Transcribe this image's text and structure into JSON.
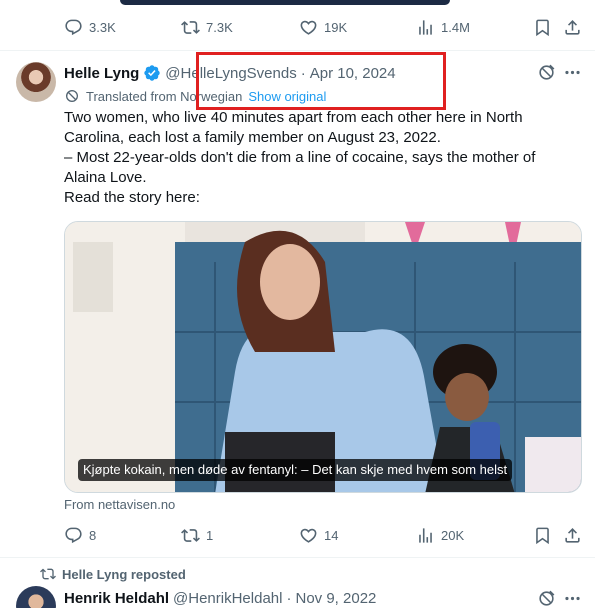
{
  "top_actions": {
    "replies": "3.3K",
    "reposts": "7.3K",
    "likes": "19K",
    "views": "1.4M"
  },
  "tweet": {
    "author_name": "Helle Lyng",
    "handle": "@HelleLyngSvends",
    "date": "Apr 10, 2024",
    "translated_label": "Translated from Norwegian",
    "show_original": "Show original",
    "text_lines": [
      "Two women, who live 40 minutes apart from each other here in North Carolina, each lost a family member on August 23, 2022.",
      "– Most 22-year-olds don't die from a line of cocaine, says the mother of Alaina Love.",
      "Read the story here:"
    ],
    "media_caption": "Kjøpte kokain, men døde av fentanyl: – Det kan skje med hvem som helst",
    "source": "From nettavisen.no",
    "actions": {
      "replies": "8",
      "reposts": "1",
      "likes": "14",
      "views": "20K"
    }
  },
  "next_tweet": {
    "repost_label": "Helle Lyng reposted",
    "author_name": "Henrik Heldahl",
    "handle": "@HenrikHeldahl",
    "date": "Nov 9, 2022"
  },
  "colors": {
    "text": "#0f1419",
    "muted": "#536471",
    "link": "#1d9bf0",
    "verified": "#1d9bf0",
    "highlight_box": "#e02020"
  }
}
